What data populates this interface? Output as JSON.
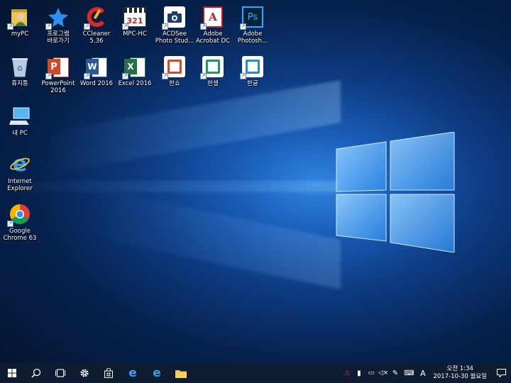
{
  "desktop": {
    "icons": [
      {
        "label": "myPC"
      },
      {
        "label": "프로그램\n바로가기"
      },
      {
        "label": "CCleaner\n5.36"
      },
      {
        "label": "MPC-HC"
      },
      {
        "label": "ACDSee\nPhoto Stud..."
      },
      {
        "label": "Adobe\nAcrobat DC"
      },
      {
        "label": "Adobe\nPhotosh..."
      },
      {
        "label": "휴지통"
      },
      {
        "label": "PowerPoint\n2016"
      },
      {
        "label": "Word 2016"
      },
      {
        "label": "Excel 2016"
      },
      {
        "label": "한쇼"
      },
      {
        "label": "한셀"
      },
      {
        "label": "한글"
      },
      {
        "label": "내 PC"
      },
      {
        "label": "Internet\nExplorer"
      },
      {
        "label": "Google\nChrome 63"
      }
    ],
    "glyphs": {
      "mpc": "321",
      "acrobat": "A",
      "photoshop": "Ps",
      "powerpoint": "P",
      "word": "W",
      "excel": "X",
      "ie": "e"
    }
  },
  "taskbar": {
    "clock_time": "오전 1:34",
    "clock_date": "2017-10-30 월요일",
    "ime": "A"
  },
  "colors": {
    "taskbar": "#101c30",
    "accent": "#1a5db8"
  }
}
